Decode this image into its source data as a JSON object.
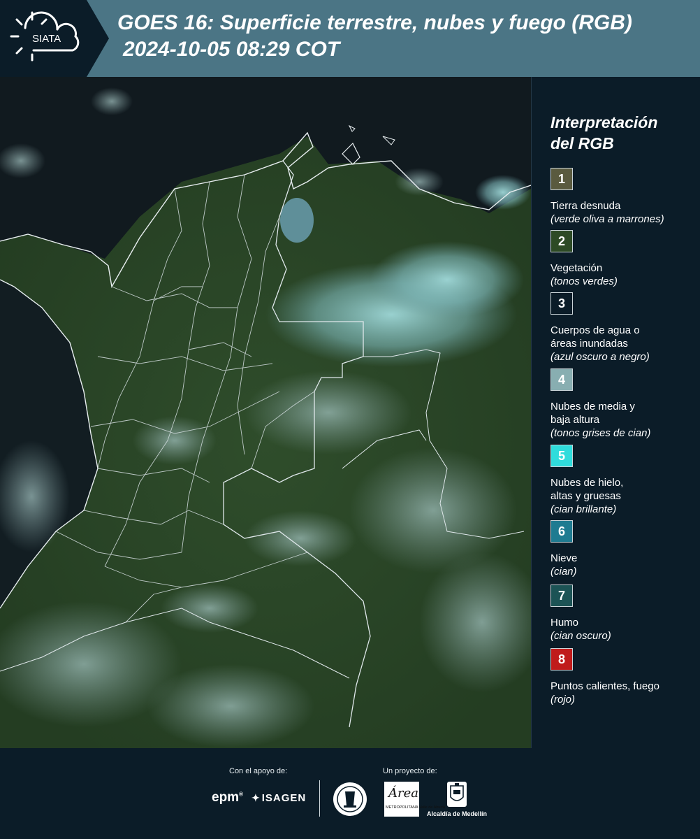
{
  "header": {
    "logo_text": "SIATA",
    "title_line1": "GOES 16: Superficie terrestre, nubes y fuego (RGB)",
    "title_line2": "2024-10-05 08:29 COT"
  },
  "legend": {
    "title": "Interpretación\ndel RGB",
    "items": [
      {
        "num": "1",
        "color": "#5a5a3f",
        "label": "Tierra desnuda",
        "note": "(verde oliva a marrones)"
      },
      {
        "num": "2",
        "color": "#2d4a25",
        "label": "Vegetación",
        "note": "(tonos verdes)"
      },
      {
        "num": "3",
        "color": "#0b1c28",
        "label": "Cuerpos de agua o\náreas inundadas",
        "note": "(azul oscuro a negro)"
      },
      {
        "num": "4",
        "color": "#88aeb1",
        "label": "Nubes de media y\nbaja altura",
        "note": "(tonos grises de cian)"
      },
      {
        "num": "5",
        "color": "#2fdcdc",
        "label": "Nubes de hielo,\naltas y gruesas",
        "note": "(cian brillante)"
      },
      {
        "num": "6",
        "color": "#1f7b91",
        "label": "Nieve",
        "note": "(cian)"
      },
      {
        "num": "7",
        "color": "#1c5355",
        "label": "Humo",
        "note": "(cian oscuro)"
      },
      {
        "num": "8",
        "color": "#c01b1b",
        "label": "Puntos calientes, fuego",
        "note": "(rojo)"
      }
    ]
  },
  "footer": {
    "support_label": "Con el apoyo de:",
    "project_label": "Un proyecto de:",
    "epm": "epm",
    "isagen": "ISAGEN",
    "area_title": "Área",
    "area_subtitle": "METROPOLITANA Valle de Aburrá",
    "medellin": "Alcaldía de Medellín"
  }
}
